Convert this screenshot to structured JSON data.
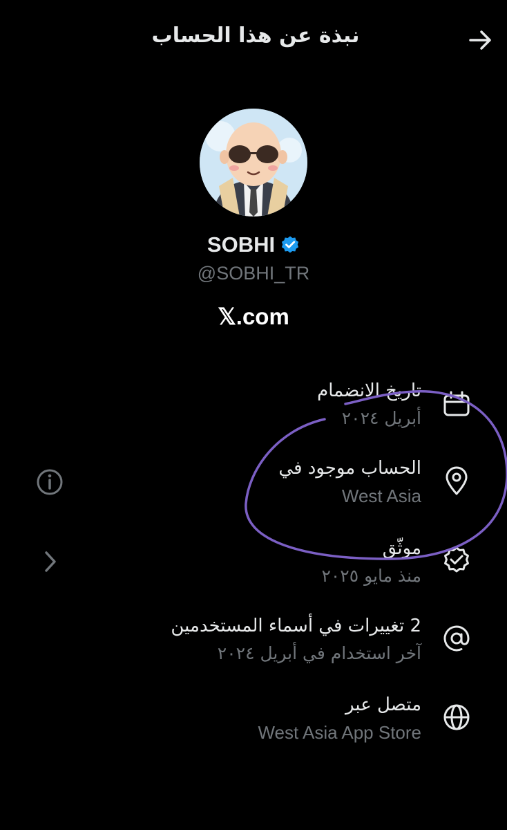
{
  "header": {
    "title": "نبذة عن هذا الحساب",
    "back_icon": "arrow-right-icon"
  },
  "profile": {
    "name": "SOBHI",
    "handle": "@SOBHI_TR",
    "verified_badge_color": "#1d9bf0",
    "site_label": "𝕏.com"
  },
  "rows": [
    {
      "icon": "calendar-icon",
      "label": "تاريخ الانضمام",
      "value": "أبريل ٢٠٢٤"
    },
    {
      "icon": "location-pin-icon",
      "label": "الحساب موجود في",
      "value": "West Asia"
    },
    {
      "icon": "verified-badge-icon",
      "label": "موثّق",
      "value": "منذ مايو ٢٠٢٥"
    },
    {
      "icon": "at-sign-icon",
      "label": "2 تغييرات في أسماء المستخدمين",
      "value": "آخر استخدام في أبريل ٢٠٢٤"
    },
    {
      "icon": "globe-icon",
      "label": "متصل عبر",
      "value": "West Asia App Store"
    }
  ],
  "side_controls": {
    "info_icon": "info-icon",
    "chevron_icon": "chevron-right-icon"
  },
  "annotation_color": "#7b5fc4"
}
